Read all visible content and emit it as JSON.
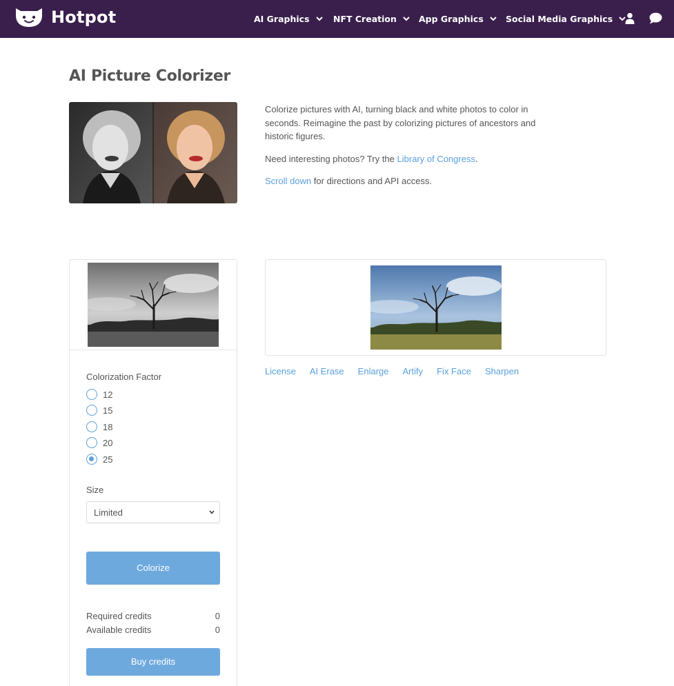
{
  "header": {
    "brand": "Hotpot",
    "nav": [
      {
        "label": "AI Graphics"
      },
      {
        "label": "NFT Creation"
      },
      {
        "label": "App Graphics"
      },
      {
        "label": "Social Media Graphics"
      }
    ],
    "icons": [
      "mascot-logo-icon",
      "user-icon",
      "chat-icon",
      "chevron-down-icon"
    ]
  },
  "page": {
    "title": "AI Picture Colorizer",
    "intro": {
      "p1": "Colorize pictures with AI, turning black and white photos to color in seconds. Reimagine the past by colorizing pictures of ancestors and historic figures.",
      "p2_prefix": "Need interesting photos? Try the ",
      "p2_link": "Library of Congress",
      "p2_suffix": ".",
      "p3_link": "Scroll down",
      "p3_suffix": " for directions and API access."
    }
  },
  "form": {
    "factor_label": "Colorization Factor",
    "factor_options": [
      "12",
      "15",
      "18",
      "20",
      "25"
    ],
    "factor_selected": "25",
    "size_label": "Size",
    "size_value": "Limited",
    "colorize_label": "Colorize",
    "required_credits_label": "Required credits",
    "required_credits_value": "0",
    "available_credits_label": "Available credits",
    "available_credits_value": "0",
    "buy_label": "Buy credits"
  },
  "tools": [
    "License",
    "AI Erase",
    "Enlarge",
    "Artify",
    "Fix Face",
    "Sharpen"
  ],
  "colors": {
    "header_bg": "#3a1f4d",
    "accent": "#5aa0dd",
    "button": "#6ea9de"
  }
}
